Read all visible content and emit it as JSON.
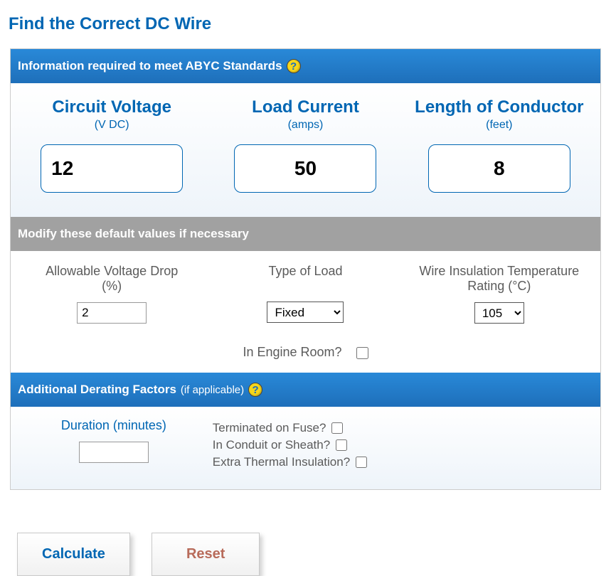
{
  "title": "Find the Correct DC Wire",
  "sections": {
    "info": {
      "header": "Information required to meet ABYC Standards",
      "voltage": {
        "label": "Circuit Voltage",
        "unit": "(V DC)",
        "value": "12"
      },
      "current": {
        "label": "Load Current",
        "unit": "(amps)",
        "value": "50"
      },
      "length": {
        "label": "Length of Conductor",
        "unit": "(feet)",
        "value": "8"
      }
    },
    "defaults": {
      "header": "Modify these default values if necessary",
      "voltage_drop": {
        "label": "Allowable Voltage Drop (%)",
        "label_line1": "Allowable Voltage Drop",
        "label_line2": "(%)",
        "value": "2"
      },
      "load_type": {
        "label": "Type of Load",
        "selected": "Fixed",
        "options": [
          "Fixed"
        ]
      },
      "insulation": {
        "label_line1": "Wire Insulation Temperature",
        "label_line2": "Rating (°C)",
        "selected": "105",
        "options": [
          "105"
        ]
      },
      "engine_room": {
        "label": "In Engine Room?",
        "checked": false
      }
    },
    "derating": {
      "header": "Additional Derating Factors",
      "header_sub": "(if applicable)",
      "duration": {
        "label": "Duration (minutes)",
        "value": ""
      },
      "terminated_fuse": {
        "label": "Terminated on Fuse?",
        "checked": false
      },
      "in_conduit": {
        "label": "In Conduit or Sheath?",
        "checked": false
      },
      "extra_thermal": {
        "label": "Extra Thermal Insulation?",
        "checked": false
      }
    }
  },
  "buttons": {
    "calculate": "Calculate",
    "reset": "Reset"
  },
  "icons": {
    "help": "?"
  }
}
